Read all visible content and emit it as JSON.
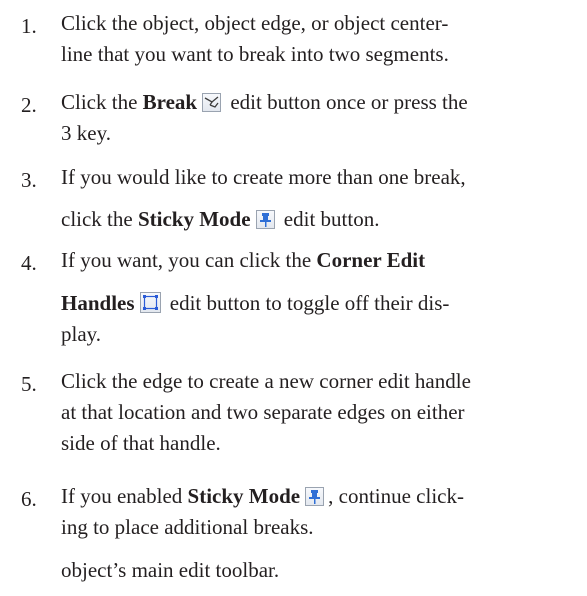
{
  "steps": [
    {
      "number": "1.",
      "lines": [
        "Click the object, object edge, or object center-",
        "line that you want to break into two segments."
      ]
    },
    {
      "number": "2.",
      "line1": {
        "pre": "Click the ",
        "bold": "Break",
        "icon": "break-icon",
        "post": " edit button once or press the"
      },
      "line2": "3 key."
    },
    {
      "number": "3.",
      "line1": "If you would like to create more than one break,",
      "line2": {
        "pre": "click the ",
        "bold": "Sticky Mode",
        "icon": "pushpin-icon",
        "post": " edit button."
      }
    },
    {
      "number": "4.",
      "line1": {
        "pre": "If you want, you can click the ",
        "bold": "Corner Edit"
      },
      "line2": {
        "bold": "Handles",
        "icon": "corner-edit-handles-icon",
        "post": " edit button to toggle off their dis-"
      },
      "line3": "play."
    },
    {
      "number": "5.",
      "lines": [
        "Click the edge to create a new corner edit handle",
        "at that location and two separate edges on either",
        "side of that handle."
      ]
    },
    {
      "number": "6.",
      "line1": {
        "pre": "If you enabled ",
        "bold": "Sticky Mode",
        "icon": "pushpin-icon",
        "post": ", continue click-"
      },
      "line2": "ing to place additional breaks."
    }
  ],
  "trailing_text": "object’s main edit toolbar.",
  "colors": {
    "text": "#231f20",
    "icon_border": "#9aa3b0",
    "pin_blue": "#2f6fd6",
    "handle_blue": "#2a5bd7"
  }
}
